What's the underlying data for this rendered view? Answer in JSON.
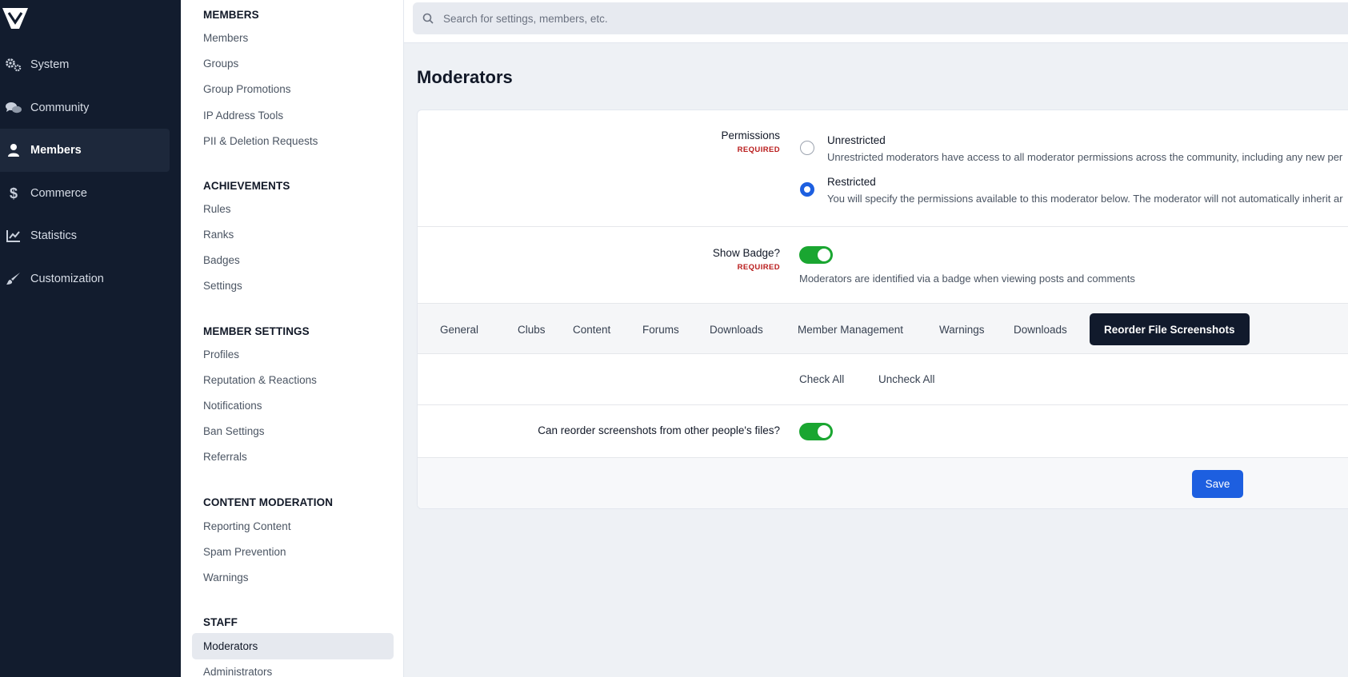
{
  "nav": {
    "items": [
      {
        "label": "System",
        "icon": "gears-icon"
      },
      {
        "label": "Community",
        "icon": "chat-bubbles-icon"
      },
      {
        "label": "Members",
        "icon": "user-icon",
        "active": true
      },
      {
        "label": "Commerce",
        "icon": "dollar-icon"
      },
      {
        "label": "Statistics",
        "icon": "line-chart-icon"
      },
      {
        "label": "Customization",
        "icon": "brush-icon"
      }
    ]
  },
  "submenu": {
    "sections": [
      {
        "heading": "MEMBERS",
        "links": [
          "Members",
          "Groups",
          "Group Promotions",
          "IP Address Tools",
          "PII & Deletion Requests"
        ]
      },
      {
        "heading": "ACHIEVEMENTS",
        "links": [
          "Rules",
          "Ranks",
          "Badges",
          "Settings"
        ]
      },
      {
        "heading": "MEMBER SETTINGS",
        "links": [
          "Profiles",
          "Reputation & Reactions",
          "Notifications",
          "Ban Settings",
          "Referrals"
        ]
      },
      {
        "heading": "CONTENT MODERATION",
        "links": [
          "Reporting Content",
          "Spam Prevention",
          "Warnings"
        ]
      },
      {
        "heading": "STAFF",
        "links": [
          "Moderators",
          "Administrators"
        ]
      }
    ]
  },
  "search": {
    "placeholder": "Search for settings, members, etc."
  },
  "page": {
    "title": "Moderators"
  },
  "form": {
    "permissions": {
      "label": "Permissions",
      "required": "REQUIRED",
      "options": [
        {
          "title": "Unrestricted",
          "desc": "Unrestricted moderators have access to all moderator permissions across the community, including any new per",
          "checked": false
        },
        {
          "title": "Restricted",
          "desc": "You will specify the permissions available to this moderator below. The moderator will not automatically inherit ar",
          "checked": true
        }
      ]
    },
    "show_badge": {
      "label": "Show Badge?",
      "required": "REQUIRED",
      "help": "Moderators are identified via a badge when viewing posts and comments",
      "on": true
    },
    "tabs": [
      "General",
      "Clubs",
      "Content",
      "Forums",
      "Downloads",
      "Member Management",
      "Warnings",
      "Downloads",
      "Reorder File Screenshots"
    ],
    "active_tab": "Reorder File Screenshots",
    "check_all": "Check All",
    "uncheck_all": "Uncheck All",
    "reorder": {
      "label": "Can reorder screenshots from other people's files?",
      "on": true
    },
    "save": "Save"
  },
  "colors": {
    "nav_bg": "#121c2e",
    "accent": "#1d5fe0",
    "toggle_on": "#1aa631",
    "required": "#b91c1c"
  }
}
